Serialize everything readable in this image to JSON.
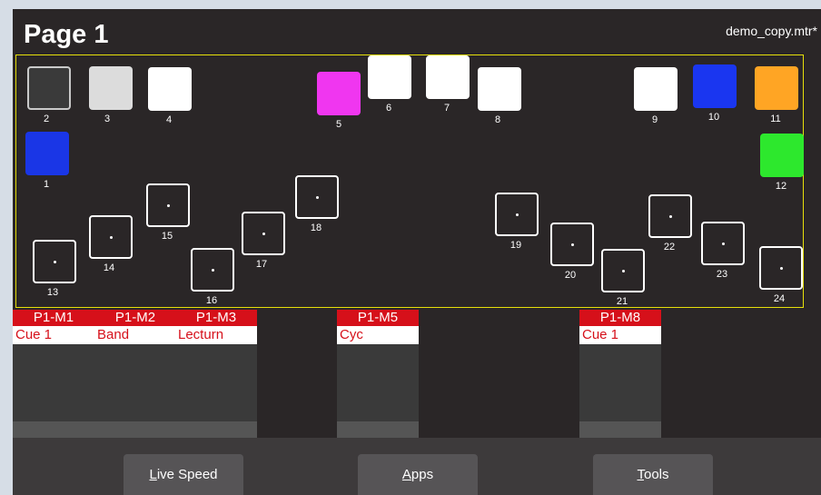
{
  "header": {
    "title": "Page 1",
    "file": "demo_copy.mtr*"
  },
  "fixtures": [
    {
      "num": "2",
      "color": "#3a3a3a"
    },
    {
      "num": "3",
      "color": "#dcdcdc"
    },
    {
      "num": "4",
      "color": "#ffffff"
    },
    {
      "num": "5",
      "color": "#f036f0"
    },
    {
      "num": "6",
      "color": "#ffffff"
    },
    {
      "num": "7",
      "color": "#ffffff"
    },
    {
      "num": "8",
      "color": "#ffffff"
    },
    {
      "num": "9",
      "color": "#ffffff"
    },
    {
      "num": "10",
      "color": "#1a36f0"
    },
    {
      "num": "11",
      "color": "#ffa524"
    },
    {
      "num": "1",
      "color": "#1a36e6"
    },
    {
      "num": "12",
      "color": "#2de82d"
    },
    {
      "num": "13",
      "color": "empty"
    },
    {
      "num": "14",
      "color": "empty"
    },
    {
      "num": "15",
      "color": "empty"
    },
    {
      "num": "16",
      "color": "empty"
    },
    {
      "num": "17",
      "color": "empty"
    },
    {
      "num": "18",
      "color": "empty"
    },
    {
      "num": "19",
      "color": "empty"
    },
    {
      "num": "20",
      "color": "empty"
    },
    {
      "num": "21",
      "color": "empty"
    },
    {
      "num": "22",
      "color": "empty"
    },
    {
      "num": "23",
      "color": "empty"
    },
    {
      "num": "24",
      "color": "empty"
    }
  ],
  "faders": [
    {
      "name": "P1-M1",
      "cue": "Cue 1"
    },
    {
      "name": "P1-M2",
      "cue": "Band"
    },
    {
      "name": "P1-M3",
      "cue": "Lecturn"
    },
    {
      "name": "P1-M5",
      "cue": "Cyc"
    },
    {
      "name": "P1-M8",
      "cue": "Cue 1"
    }
  ],
  "buttons": {
    "live_speed": {
      "u": "L",
      "rest": "ive Speed"
    },
    "apps": {
      "u": "A",
      "rest": "pps"
    },
    "tools": {
      "u": "T",
      "rest": "ools"
    }
  }
}
